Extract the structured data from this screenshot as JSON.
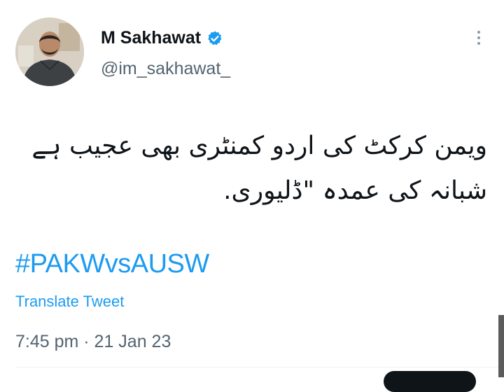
{
  "tweet": {
    "author": {
      "display_name": "M Sakhawat",
      "handle": "@im_sakhawat_",
      "verified": true,
      "avatar_icon": "profile-photo"
    },
    "more_icon": "more-vertical-icon",
    "text_lines": [
      "ویمن کرکٹ کی اردو کمنٹری بھی عجیب ہے",
      "شبانہ کی عمدہ \"ڈلیوری."
    ],
    "hashtag": "#PAKWvsAUSW",
    "translate_label": "Translate Tweet",
    "timestamp": "7:45 pm · 21 Jan 23"
  },
  "colors": {
    "text_primary": "#0f1419",
    "text_secondary": "#536471",
    "accent": "#1d9bf0"
  }
}
